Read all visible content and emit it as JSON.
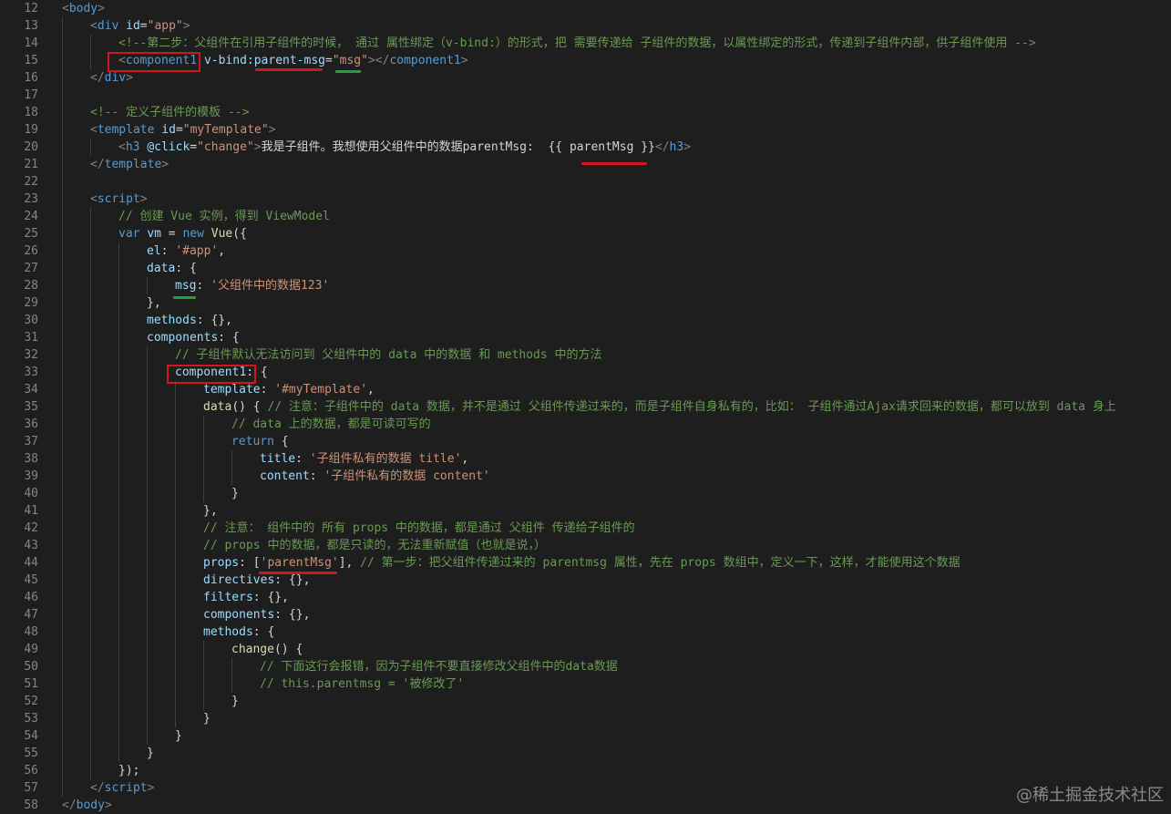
{
  "editor": {
    "language": "html",
    "theme_colors": {
      "background": "#1e1e1e",
      "tag": "#569cd6",
      "attribute": "#9cdcfe",
      "string": "#ce9178",
      "comment": "#6a9955",
      "line_number": "#858585",
      "highlight_red": "#d0181c",
      "highlight_green": "#1da23c"
    },
    "lines": [
      {
        "n": "12",
        "indent": 0,
        "tokens": [
          [
            "t-punc",
            "<"
          ],
          [
            "t-tag",
            "body"
          ],
          [
            "t-punc",
            ">"
          ]
        ]
      },
      {
        "n": "13",
        "indent": 1,
        "tokens": [
          [
            "t-punc",
            "<"
          ],
          [
            "t-tag",
            "div "
          ],
          [
            "t-attr",
            "id"
          ],
          [
            "t-plain",
            "="
          ],
          [
            "t-str",
            "\"app\""
          ],
          [
            "t-punc",
            ">"
          ]
        ]
      },
      {
        "n": "14",
        "indent": 2,
        "tokens": [
          [
            "t-com",
            "<!--第二步：父组件在引用子组件的时候， 通过 属性绑定（v-bind:）的形式，把 需要传递给 子组件的数据，以属性绑定的形式，传递到子组件内部，供子组件使用 -->"
          ]
        ]
      },
      {
        "n": "15",
        "indent": 2,
        "tokens": [
          [
            "t-punc",
            "<"
          ],
          [
            "t-tag",
            "component1"
          ],
          [
            "t-plain",
            " "
          ],
          [
            "t-attr",
            "v-bind:parent-msg"
          ],
          [
            "t-plain",
            "="
          ],
          [
            "t-str",
            "\"msg\""
          ],
          [
            "t-punc",
            "></"
          ],
          [
            "t-tag",
            "component1"
          ],
          [
            "t-punc",
            ">"
          ]
        ]
      },
      {
        "n": "16",
        "indent": 1,
        "tokens": [
          [
            "t-punc",
            "</"
          ],
          [
            "t-tag",
            "div"
          ],
          [
            "t-punc",
            ">"
          ]
        ]
      },
      {
        "n": "17",
        "indent": 1,
        "tokens": []
      },
      {
        "n": "18",
        "indent": 1,
        "tokens": [
          [
            "t-com",
            "<!-- 定义子组件的模板 -->"
          ]
        ]
      },
      {
        "n": "19",
        "indent": 1,
        "tokens": [
          [
            "t-punc",
            "<"
          ],
          [
            "t-tag",
            "template "
          ],
          [
            "t-attr",
            "id"
          ],
          [
            "t-plain",
            "="
          ],
          [
            "t-str",
            "\"myTemplate\""
          ],
          [
            "t-punc",
            ">"
          ]
        ]
      },
      {
        "n": "20",
        "indent": 2,
        "tokens": [
          [
            "t-punc",
            "<"
          ],
          [
            "t-tag",
            "h3 "
          ],
          [
            "t-attr",
            "@click"
          ],
          [
            "t-plain",
            "="
          ],
          [
            "t-str",
            "\"change\""
          ],
          [
            "t-punc",
            ">"
          ],
          [
            "t-plain",
            "我是子组件。我想使用父组件中的数据parentMsg:  {{ parentMsg }}"
          ],
          [
            "t-punc",
            "</"
          ],
          [
            "t-tag",
            "h3"
          ],
          [
            "t-punc",
            ">"
          ]
        ]
      },
      {
        "n": "21",
        "indent": 1,
        "tokens": [
          [
            "t-punc",
            "</"
          ],
          [
            "t-tag",
            "template"
          ],
          [
            "t-punc",
            ">"
          ]
        ]
      },
      {
        "n": "22",
        "indent": 1,
        "tokens": []
      },
      {
        "n": "23",
        "indent": 1,
        "tokens": [
          [
            "t-punc",
            "<"
          ],
          [
            "t-tag",
            "script"
          ],
          [
            "t-punc",
            ">"
          ]
        ]
      },
      {
        "n": "24",
        "indent": 2,
        "tokens": [
          [
            "t-com",
            "// 创建 Vue 实例，得到 ViewModel"
          ]
        ]
      },
      {
        "n": "25",
        "indent": 2,
        "tokens": [
          [
            "t-kw",
            "var "
          ],
          [
            "t-key",
            "vm"
          ],
          [
            "t-plain",
            " = "
          ],
          [
            "t-kw",
            "new "
          ],
          [
            "t-fn",
            "Vue"
          ],
          [
            "t-plain",
            "({"
          ]
        ]
      },
      {
        "n": "26",
        "indent": 3,
        "tokens": [
          [
            "t-key",
            "el"
          ],
          [
            "t-plain",
            ": "
          ],
          [
            "t-str",
            "'#app'"
          ],
          [
            "t-plain",
            ","
          ]
        ]
      },
      {
        "n": "27",
        "indent": 3,
        "tokens": [
          [
            "t-key",
            "data"
          ],
          [
            "t-plain",
            ": {"
          ]
        ]
      },
      {
        "n": "28",
        "indent": 4,
        "tokens": [
          [
            "t-key",
            "msg"
          ],
          [
            "t-plain",
            ": "
          ],
          [
            "t-str",
            "'父组件中的数据123'"
          ]
        ]
      },
      {
        "n": "29",
        "indent": 3,
        "tokens": [
          [
            "t-plain",
            "},"
          ]
        ]
      },
      {
        "n": "30",
        "indent": 3,
        "tokens": [
          [
            "t-key",
            "methods"
          ],
          [
            "t-plain",
            ": {},"
          ]
        ]
      },
      {
        "n": "31",
        "indent": 3,
        "tokens": [
          [
            "t-key",
            "components"
          ],
          [
            "t-plain",
            ": {"
          ]
        ]
      },
      {
        "n": "32",
        "indent": 4,
        "tokens": [
          [
            "t-com",
            "// 子组件默认无法访问到 父组件中的 data 中的数据 和 methods 中的方法"
          ]
        ]
      },
      {
        "n": "33",
        "indent": 4,
        "tokens": [
          [
            "t-key",
            "component1"
          ],
          [
            "t-plain",
            ": {"
          ]
        ]
      },
      {
        "n": "34",
        "indent": 5,
        "tokens": [
          [
            "t-key",
            "template"
          ],
          [
            "t-plain",
            ": "
          ],
          [
            "t-str",
            "'#myTemplate'"
          ],
          [
            "t-plain",
            ","
          ]
        ]
      },
      {
        "n": "35",
        "indent": 5,
        "tokens": [
          [
            "t-fn",
            "data"
          ],
          [
            "t-plain",
            "() { "
          ],
          [
            "t-com",
            "// 注意：子组件中的 data 数据，并不是通过 父组件传递过来的，而是子组件自身私有的，比如： 子组件通过Ajax请求回来的数据，都可以放到 data 身上"
          ]
        ]
      },
      {
        "n": "36",
        "indent": 6,
        "tokens": [
          [
            "t-com",
            "// data 上的数据，都是可读可写的"
          ]
        ]
      },
      {
        "n": "37",
        "indent": 6,
        "tokens": [
          [
            "t-kw",
            "return"
          ],
          [
            "t-plain",
            " {"
          ]
        ]
      },
      {
        "n": "38",
        "indent": 7,
        "tokens": [
          [
            "t-key",
            "title"
          ],
          [
            "t-plain",
            ": "
          ],
          [
            "t-str",
            "'子组件私有的数据 title'"
          ],
          [
            "t-plain",
            ","
          ]
        ]
      },
      {
        "n": "39",
        "indent": 7,
        "tokens": [
          [
            "t-key",
            "content"
          ],
          [
            "t-plain",
            ": "
          ],
          [
            "t-str",
            "'子组件私有的数据 content'"
          ]
        ]
      },
      {
        "n": "40",
        "indent": 6,
        "tokens": [
          [
            "t-plain",
            "}"
          ]
        ]
      },
      {
        "n": "41",
        "indent": 5,
        "tokens": [
          [
            "t-plain",
            "},"
          ]
        ]
      },
      {
        "n": "42",
        "indent": 5,
        "tokens": [
          [
            "t-com",
            "// 注意： 组件中的 所有 props 中的数据，都是通过 父组件 传递给子组件的"
          ]
        ]
      },
      {
        "n": "43",
        "indent": 5,
        "tokens": [
          [
            "t-com",
            "// props 中的数据，都是只读的，无法重新赋值（也就是说，）"
          ]
        ]
      },
      {
        "n": "44",
        "indent": 5,
        "tokens": [
          [
            "t-key",
            "props"
          ],
          [
            "t-plain",
            ": ["
          ],
          [
            "t-str",
            "'parentMsg'"
          ],
          [
            "t-plain",
            "], "
          ],
          [
            "t-com",
            "// 第一步：把父组件传递过来的 parentmsg 属性，先在 props 数组中，定义一下，这样，才能使用这个数据"
          ]
        ]
      },
      {
        "n": "45",
        "indent": 5,
        "tokens": [
          [
            "t-key",
            "directives"
          ],
          [
            "t-plain",
            ": {},"
          ]
        ]
      },
      {
        "n": "46",
        "indent": 5,
        "tokens": [
          [
            "t-key",
            "filters"
          ],
          [
            "t-plain",
            ": {},"
          ]
        ]
      },
      {
        "n": "47",
        "indent": 5,
        "tokens": [
          [
            "t-key",
            "components"
          ],
          [
            "t-plain",
            ": {},"
          ]
        ]
      },
      {
        "n": "48",
        "indent": 5,
        "tokens": [
          [
            "t-key",
            "methods"
          ],
          [
            "t-plain",
            ": {"
          ]
        ]
      },
      {
        "n": "49",
        "indent": 6,
        "tokens": [
          [
            "t-fn",
            "change"
          ],
          [
            "t-plain",
            "() {"
          ]
        ]
      },
      {
        "n": "50",
        "indent": 7,
        "tokens": [
          [
            "t-com",
            "// 下面这行会报错，因为子组件不要直接修改父组件中的data数据"
          ]
        ]
      },
      {
        "n": "51",
        "indent": 7,
        "tokens": [
          [
            "t-com",
            "// this.parentmsg = '被修改了'"
          ]
        ]
      },
      {
        "n": "52",
        "indent": 6,
        "tokens": [
          [
            "t-plain",
            "}"
          ]
        ]
      },
      {
        "n": "53",
        "indent": 5,
        "tokens": [
          [
            "t-plain",
            "}"
          ]
        ]
      },
      {
        "n": "54",
        "indent": 4,
        "tokens": [
          [
            "t-plain",
            "}"
          ]
        ]
      },
      {
        "n": "55",
        "indent": 3,
        "tokens": [
          [
            "t-plain",
            "}"
          ]
        ]
      },
      {
        "n": "56",
        "indent": 2,
        "tokens": [
          [
            "t-plain",
            "});"
          ]
        ]
      },
      {
        "n": "57",
        "indent": 1,
        "tokens": [
          [
            "t-punc",
            "</"
          ],
          [
            "t-tag",
            "script"
          ],
          [
            "t-punc",
            ">"
          ]
        ]
      },
      {
        "n": "58",
        "indent": 0,
        "tokens": [
          [
            "t-punc",
            "</"
          ],
          [
            "t-tag",
            "body"
          ],
          [
            "t-punc",
            ">"
          ]
        ]
      }
    ]
  },
  "watermark": "@稀土掘金技术社区"
}
